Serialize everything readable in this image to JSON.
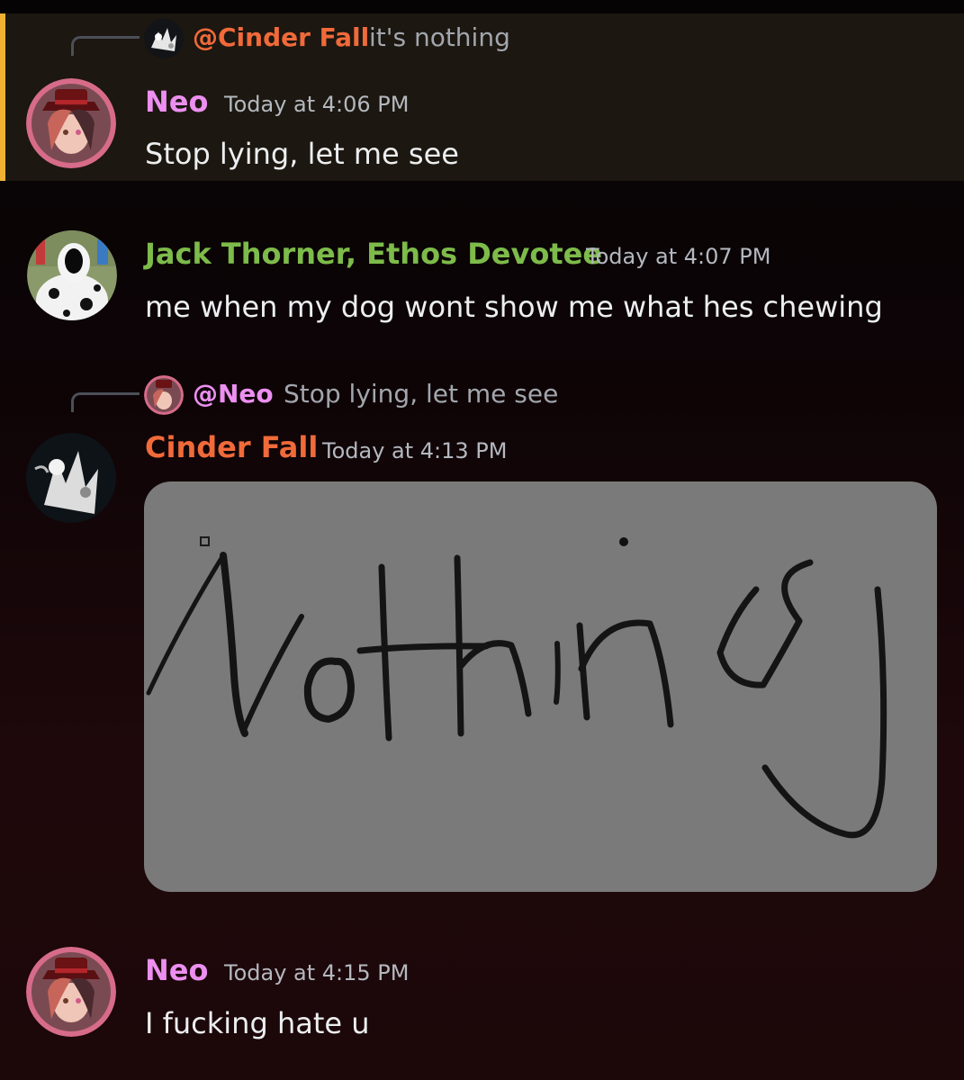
{
  "messages": [
    {
      "highlighted": true,
      "reply": {
        "mention": "@Cinder Fall",
        "text": "it's nothing",
        "mention_color": "#f06a3a",
        "avatar_icon": "cinder-fall-avatar-icon"
      },
      "author": "Neo",
      "author_color": "#ec8ff0",
      "timestamp": "Today at 4:06 PM",
      "text": "Stop lying, let me see",
      "avatar_icon": "neo-avatar-icon"
    },
    {
      "author": "Jack Thorner, Ethos Devotee",
      "author_color": "#7dbb4a",
      "timestamp": "Today at 4:07 PM",
      "text": "me when my dog wont show me what hes chewing",
      "avatar_icon": "jack-thorner-avatar-icon"
    },
    {
      "reply": {
        "mention": "@Neo",
        "text": "Stop lying, let me see",
        "mention_color": "#ec8ff0",
        "avatar_icon": "neo-avatar-icon"
      },
      "author": "Cinder Fall",
      "author_color": "#f06a3a",
      "timestamp": "Today at 4:13 PM",
      "attachment": {
        "handwritten_text": "Nothing",
        "background": "#7a7a7a"
      },
      "avatar_icon": "cinder-fall-avatar-icon"
    },
    {
      "author": "Neo",
      "author_color": "#ec8ff0",
      "timestamp": "Today at 4:15 PM",
      "text": "I fucking hate u",
      "avatar_icon": "neo-avatar-icon"
    }
  ],
  "colors": {
    "highlight_bar": "#f0b232",
    "highlight_bg": "#1c1710",
    "timestamp": "#b4b8bf",
    "reply_text": "#a2a6ad"
  }
}
